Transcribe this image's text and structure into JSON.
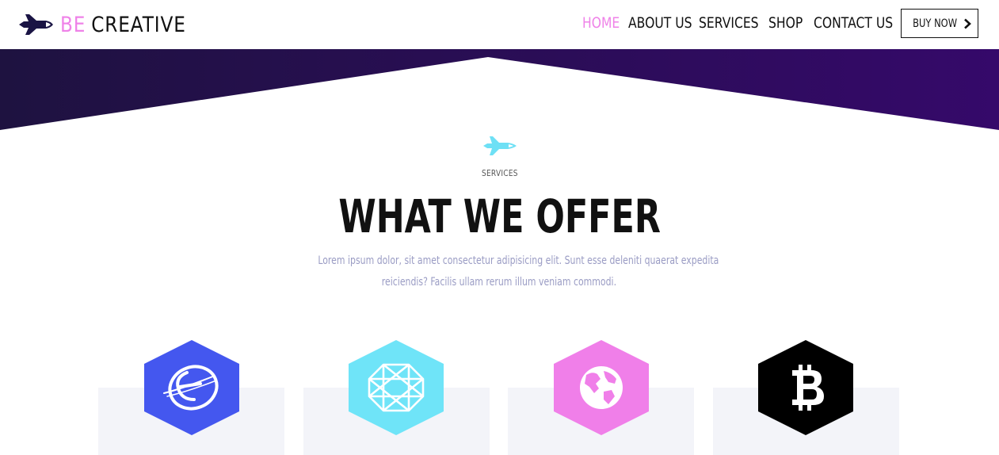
{
  "brand": {
    "prefix": "BE",
    "name": "CREATIVE",
    "accent_color": "#ef82e8",
    "icon": "space-shuttle-icon"
  },
  "nav": {
    "items": [
      {
        "label": "HOME",
        "active": true
      },
      {
        "label": "ABOUT US",
        "active": false
      },
      {
        "label": "SERVICES",
        "active": false
      },
      {
        "label": "SHOP",
        "active": false
      },
      {
        "label": "CONTACT US",
        "active": false
      }
    ],
    "cta_label": "BUY NOW",
    "cta_icon": "chevron-right-icon"
  },
  "banner": {
    "gradient_start": "#1e1240",
    "gradient_end": "#35096a"
  },
  "services": {
    "icon": "space-shuttle-icon",
    "icon_color": "#6ee0f5",
    "eyebrow": "SERVICES",
    "title": "WHAT WE OFFER",
    "description_line1": "Lorem ipsum dolor, sit amet consectetur adipisicing elit. Sunt esse deleniti quaerat expedita",
    "description_line2": "reiciendis? Facilis ullam rerum illum veniam commodi.",
    "cards": [
      {
        "icon": "orbit-e-icon",
        "color": "#4457ef"
      },
      {
        "icon": "geometric-network-icon",
        "color": "#6fe4f8"
      },
      {
        "icon": "globe-icon",
        "color": "#f07fe9"
      },
      {
        "icon": "bitcoin-icon",
        "color": "#000000"
      }
    ]
  }
}
